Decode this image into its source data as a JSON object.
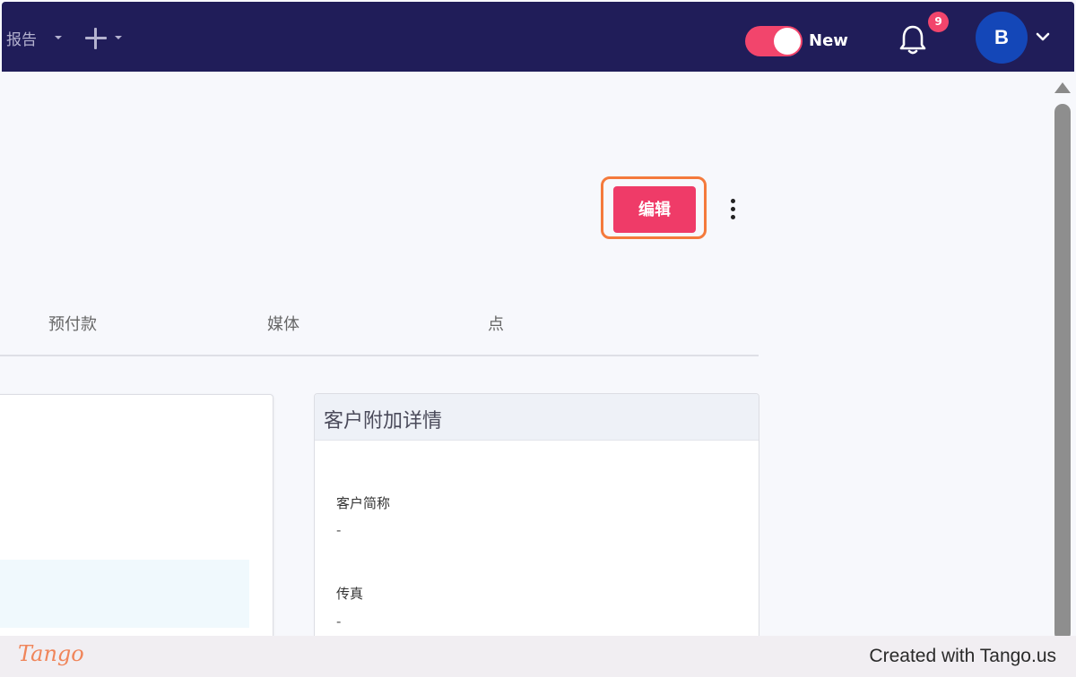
{
  "topbar": {
    "nav_report_label": "报告",
    "new_toggle_label": "New",
    "notification_count": "9",
    "avatar_initial": "B",
    "toggle_color": "#f2456c",
    "bar_color": "#201d59"
  },
  "header": {
    "edit_label": "编辑"
  },
  "tabs": [
    {
      "label": "预付款"
    },
    {
      "label": "媒体"
    },
    {
      "label": "点"
    }
  ],
  "extra_details_card": {
    "title": "客户附加详情",
    "fields": [
      {
        "label": "客户简称",
        "value": "-"
      },
      {
        "label": "传真",
        "value": "-"
      }
    ]
  },
  "footer": {
    "logo_text": "Tango",
    "created_text": "Created with Tango.us"
  }
}
